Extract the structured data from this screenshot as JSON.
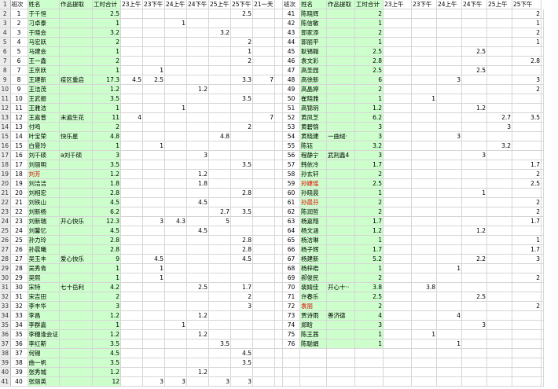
{
  "theme": {
    "green": "#ccffcc",
    "red": "#e00000",
    "header_bg": "#ececec",
    "gridline": "#d6d6d6"
  },
  "headers": [
    "班次",
    "姓名",
    "作品提取",
    "工时合计",
    "23上午",
    "23下午",
    "24上午",
    "24下午",
    "25上午",
    "25下午",
    "21一天",
    "",
    "班次",
    "姓名",
    "作品提取",
    "工时合计",
    "23上午",
    "23下午",
    "24上午",
    "24下午",
    "25上午",
    "25下午"
  ],
  "left_rows": [
    [
      "1",
      "于千恒",
      "",
      "2.5",
      "",
      "",
      "",
      "",
      "",
      "2.5",
      ""
    ],
    [
      "2",
      "刁卓泰",
      "",
      "1",
      "",
      "",
      "1",
      "",
      "",
      "",
      ""
    ],
    [
      "3",
      "于晓会",
      "",
      "3.2",
      "",
      "",
      "",
      "",
      "3.2",
      "",
      ""
    ],
    [
      "4",
      "马宏跃",
      "",
      "2",
      "",
      "",
      "",
      "",
      "",
      "2",
      ""
    ],
    [
      "5",
      "马建会",
      "",
      "1",
      "",
      "",
      "",
      "",
      "",
      "1",
      ""
    ],
    [
      "6",
      "王一鑫",
      "",
      "2",
      "",
      "",
      "",
      "",
      "",
      "2",
      ""
    ],
    [
      "7",
      "王京跃",
      "",
      "1",
      "",
      "1",
      "",
      "",
      "",
      "",
      ""
    ],
    [
      "8",
      "王建新",
      "疫区重启",
      "17.3",
      "4.5",
      "2.5",
      "",
      "",
      "",
      "3.3",
      "7"
    ],
    [
      "9",
      "王洁茂",
      "",
      "1.2",
      "",
      "",
      "",
      "1.2",
      "",
      "",
      ""
    ],
    [
      "10",
      "王武振",
      "",
      "3.5",
      "",
      "",
      "",
      "",
      "",
      "3.5",
      ""
    ],
    [
      "11",
      "王雅洁",
      "",
      "1",
      "",
      "",
      "1",
      "",
      "",
      "",
      ""
    ],
    [
      "12",
      "王嘉普",
      "末遍生花",
      "11",
      "4",
      "",
      "",
      "",
      "",
      "",
      "7"
    ],
    [
      "13",
      "付鸣",
      "",
      "2",
      "",
      "",
      "",
      "",
      "",
      "2",
      ""
    ],
    [
      "14",
      "叶宝荣",
      "快乐星",
      "4.8",
      "",
      "",
      "",
      "",
      "4.8",
      "",
      ""
    ],
    [
      "15",
      "白曼玲",
      "",
      "1",
      "",
      "1",
      "",
      "",
      "",
      "",
      ""
    ],
    [
      "16",
      "刘千硕",
      "a刘千硕",
      "3",
      "",
      "",
      "",
      "3",
      "",
      "",
      ""
    ],
    [
      "17",
      "刘丽明",
      "",
      "3.5",
      "",
      "",
      "",
      "",
      "",
      "3.5",
      ""
    ],
    [
      "18",
      "刘芳",
      "",
      "1.2",
      "",
      "",
      "",
      "1.2",
      "",
      "",
      ""
    ],
    [
      "19",
      "刘洁洁",
      "",
      "1.8",
      "",
      "",
      "",
      "1.8",
      "",
      "",
      ""
    ],
    [
      "20",
      "刘相宏",
      "",
      "2.8",
      "",
      "",
      "",
      "",
      "",
      "2.8",
      ""
    ],
    [
      "21",
      "刘铁山",
      "",
      "4.5",
      "",
      "",
      "",
      "4.5",
      "",
      "",
      ""
    ],
    [
      "22",
      "刘新杨",
      "",
      "6.2",
      "",
      "",
      "",
      "",
      "2.7",
      "3.5",
      ""
    ],
    [
      "23",
      "刘新瑞",
      "开心快乐",
      "12.3",
      "",
      "3",
      "4.3",
      "",
      "5",
      "",
      ""
    ],
    [
      "24",
      "刘馨忆",
      "",
      "4.5",
      "",
      "",
      "",
      "4.5",
      "",
      "",
      ""
    ],
    [
      "25",
      "孙力玲",
      "",
      "2.8",
      "",
      "",
      "",
      "",
      "",
      "2.8",
      ""
    ],
    [
      "26",
      "孙晨曦",
      "",
      "2.8",
      "",
      "",
      "",
      "",
      "",
      "2.8",
      ""
    ],
    [
      "27",
      "吴玉丰",
      "爱心快乐",
      "9",
      "",
      "4.5",
      "",
      "",
      "",
      "4.5",
      ""
    ],
    [
      "28",
      "吴秀青",
      "",
      "1",
      "",
      "1",
      "",
      "",
      "",
      "",
      ""
    ],
    [
      "29",
      "吴熙",
      "",
      "1",
      "",
      "1",
      "",
      "",
      "",
      "",
      ""
    ],
    [
      "30",
      "宋特",
      "七十岳利",
      "4.2",
      "",
      "",
      "",
      "2.5",
      "",
      "1.7",
      ""
    ],
    [
      "31",
      "宋吉田",
      "",
      "2",
      "",
      "",
      "",
      "",
      "",
      "2",
      ""
    ],
    [
      "32",
      "李丰华",
      "",
      "3",
      "",
      "",
      "",
      "",
      "",
      "3",
      ""
    ],
    [
      "33",
      "李昌",
      "",
      "1.2",
      "",
      "",
      "",
      "1.2",
      "",
      "",
      ""
    ],
    [
      "34",
      "李群嘉",
      "",
      "1",
      "",
      "",
      "1",
      "",
      "",
      "",
      ""
    ],
    [
      "35",
      "李穗逢会证",
      "",
      "1.2",
      "",
      "",
      "",
      "1.2",
      "",
      "",
      ""
    ],
    [
      "36",
      "李红斯",
      "",
      "3.5",
      "",
      "",
      "",
      "",
      "3.5",
      "",
      ""
    ],
    [
      "37",
      "何锡",
      "",
      "4.5",
      "",
      "",
      "",
      "",
      "",
      "4.5",
      ""
    ],
    [
      "38",
      "曲一帆",
      "",
      "3.5",
      "",
      "",
      "",
      "",
      "",
      "3.5",
      ""
    ],
    [
      "39",
      "张秀城",
      "",
      "1.2",
      "",
      "",
      "",
      "1.2",
      "",
      "",
      ""
    ],
    [
      "40",
      "张丽英",
      "",
      "12",
      "",
      "3",
      "3",
      "",
      "3",
      "3",
      ""
    ]
  ],
  "right_rows": [
    [
      "41",
      "陈晓辉",
      "",
      "2",
      "",
      "",
      "",
      "",
      "",
      "2"
    ],
    [
      "42",
      "陈信敏",
      "",
      "1",
      "",
      "",
      "",
      "",
      "",
      "1"
    ],
    [
      "43",
      "郭家添",
      "",
      "2",
      "",
      "",
      "",
      "",
      "",
      "2"
    ],
    [
      "44",
      "郭丽平",
      "",
      "1",
      "",
      "",
      "",
      "",
      "",
      "1"
    ],
    [
      "45",
      "耿锡翰",
      "",
      "2.5",
      "",
      "",
      "",
      "2.5",
      "",
      ""
    ],
    [
      "46",
      "袁文彩",
      "",
      "2.8",
      "",
      "",
      "",
      "",
      "",
      "2.8"
    ],
    [
      "47",
      "高圣园",
      "",
      "2.5",
      "",
      "",
      "",
      "2.5",
      "",
      ""
    ],
    [
      "48",
      "高徐新",
      "",
      "6",
      "",
      "",
      "3",
      "",
      "",
      "3"
    ],
    [
      "49",
      "高晶婷",
      "",
      "2",
      "",
      "",
      "",
      "",
      "",
      "2"
    ],
    [
      "50",
      "崔晓雅",
      "",
      "1",
      "",
      "1",
      "",
      "",
      "",
      ""
    ],
    [
      "51",
      "高锦玥",
      "",
      "1.2",
      "",
      "",
      "",
      "1.2",
      "",
      ""
    ],
    [
      "52",
      "黄凤芝",
      "",
      "6.2",
      "",
      "",
      "",
      "",
      "2.7",
      "3.5"
    ],
    [
      "53",
      "黄碧锦",
      "",
      "3",
      "",
      "",
      "",
      "",
      "3",
      ""
    ],
    [
      "54",
      "黄晓建",
      "一曲绒·",
      "3",
      "",
      "",
      "3",
      "",
      "",
      ""
    ],
    [
      "55",
      "陈钰",
      "",
      "3.2",
      "",
      "",
      "",
      "",
      "3.2",
      ""
    ],
    [
      "56",
      "程静宁",
      "武刑鑫4",
      "3",
      "",
      "",
      "",
      "3",
      "",
      ""
    ],
    [
      "57",
      "韩依冷",
      "",
      "1.7",
      "",
      "",
      "",
      "",
      "",
      "1.7"
    ],
    [
      "58",
      "孙玄轩",
      "",
      "2",
      "",
      "",
      "",
      "",
      "",
      "2"
    ],
    [
      "59",
      "孙婕瑶",
      "",
      "2.5",
      "",
      "",
      "",
      "",
      "",
      "2.5"
    ],
    [
      "60",
      "孙晓晨",
      "",
      "1",
      "",
      "",
      "",
      "1",
      "",
      ""
    ],
    [
      "61",
      "孙晨芬",
      "",
      "2",
      "",
      "",
      "",
      "",
      "",
      "2"
    ],
    [
      "62",
      "陈润哲",
      "",
      "2",
      "",
      "",
      "",
      "",
      "",
      "2"
    ],
    [
      "63",
      "杨嘉翔",
      "",
      "1.7",
      "",
      "",
      "",
      "",
      "",
      "1.7"
    ],
    [
      "64",
      "杨文涵",
      "",
      "1.2",
      "",
      "",
      "",
      "1.2",
      "",
      ""
    ],
    [
      "65",
      "杨洁琳",
      "",
      "1",
      "",
      "",
      "",
      "",
      "",
      "1"
    ],
    [
      "66",
      "杨子辉",
      "",
      "1.7",
      "",
      "",
      "",
      "",
      "",
      "1.7"
    ],
    [
      "67",
      "杨建新",
      "",
      "5.2",
      "",
      "",
      "",
      "2.2",
      "",
      "3"
    ],
    [
      "68",
      "杨梓皓",
      "",
      "1",
      "",
      "",
      "1",
      "",
      "",
      ""
    ],
    [
      "69",
      "郝俊民",
      "",
      "2",
      "",
      "",
      "",
      "",
      "",
      "2"
    ],
    [
      "70",
      "裴婧佳",
      "开心十··",
      "3.8",
      "",
      "3.8",
      "",
      "",
      "",
      ""
    ],
    [
      "71",
      "许春乐",
      "",
      "2.5",
      "",
      "",
      "",
      "2.5",
      "",
      ""
    ],
    [
      "72",
      "袁丽",
      "",
      "2",
      "",
      "",
      "",
      "",
      "",
      "2"
    ],
    [
      "73",
      "贾诗雨",
      "善济德",
      "4",
      "",
      "",
      "4",
      "",
      "",
      ""
    ],
    [
      "74",
      "郑晗",
      "",
      "3",
      "",
      "",
      "",
      "3",
      "",
      ""
    ],
    [
      "75",
      "陈王茜",
      "",
      "1",
      "",
      "1",
      "",
      "",
      "",
      ""
    ],
    [
      "76",
      "陈聪娟",
      "",
      "1",
      "",
      "",
      "1",
      "",
      "",
      ""
    ]
  ]
}
